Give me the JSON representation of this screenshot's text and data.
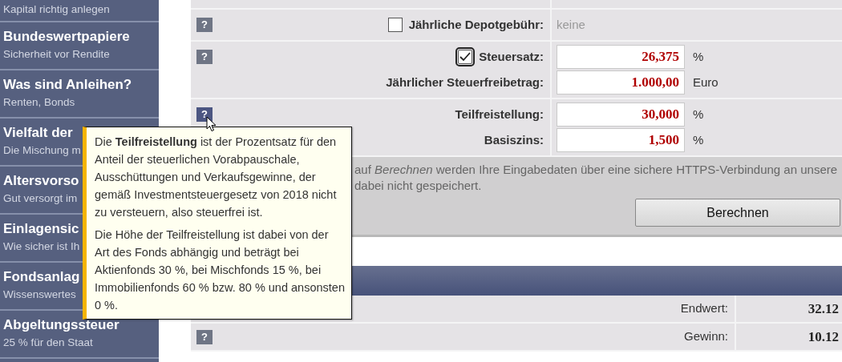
{
  "sidebar": {
    "items": [
      {
        "subtitle": "Kapital richtig anlegen"
      },
      {
        "title": "Bundeswertpapiere",
        "subtitle": "Sicherheit vor Rendite"
      },
      {
        "title": "Was sind Anleihen?",
        "subtitle": "Renten, Bonds"
      },
      {
        "title": "Vielfalt der",
        "subtitle": "Die Mischung m"
      },
      {
        "title": "Altersvorso",
        "subtitle": "Gut versorgt im"
      },
      {
        "title": "Einlagensic",
        "subtitle": "Wie sicher ist Ih"
      },
      {
        "title": "Fondsanlag",
        "subtitle": "Wissenswertes"
      },
      {
        "title": "Abgeltungssteuer",
        "subtitle": "25 % für den Staat"
      }
    ]
  },
  "form": {
    "sections": [
      {
        "help": "?",
        "hovered": false,
        "rows": [
          {
            "kind": "checkbox-text",
            "label": "Jährliche Depotgebühr:",
            "checked": false,
            "value": "keine"
          }
        ]
      },
      {
        "help": "?",
        "hovered": false,
        "rows": [
          {
            "kind": "checkbox-input",
            "label": "Steuersatz:",
            "checked": true,
            "value": "26,375",
            "unit": "%"
          },
          {
            "kind": "input",
            "label": "Jährlicher Steuerfreibetrag:",
            "value": "1.000,00",
            "unit": "Euro"
          }
        ]
      },
      {
        "help": "?",
        "hovered": true,
        "rows": [
          {
            "kind": "input",
            "label": "Teilfreistellung:",
            "value": "30,000",
            "unit": "%"
          },
          {
            "kind": "input",
            "label": "Basiszins:",
            "value": "1,500",
            "unit": "%"
          }
        ]
      }
    ]
  },
  "notice": {
    "lines": [
      "auf *Berechnen* werden Ihre Eingabedaten über eine sichere HTTPS-Verbindung an unsere",
      "dabei nicht gespeichert."
    ],
    "button": "Berechnen"
  },
  "results": {
    "rows": [
      {
        "label": "Endwert:",
        "value": "32.12"
      },
      {
        "help": "?",
        "label": "Gewinn:",
        "value": "10.12"
      }
    ]
  },
  "tooltip": {
    "paragraphs": [
      "Die **Teilfreistellung** ist der Prozentsatz für den Anteil der steuerlichen Vorabpauschale, Ausschüttungen und Verkaufsgewinne, der gemäß Investmentsteuergesetz von 2018 nicht zu versteuern, also steuerfrei ist.",
      "Die Höhe der Teilfreistellung ist dabei von der Art des Fonds abhängig und beträgt bei Aktienfonds 30 %, bei Mischfonds 15 %, bei Immobilienfonds 60 % bzw. 80 % und ansonsten 0 %."
    ]
  }
}
